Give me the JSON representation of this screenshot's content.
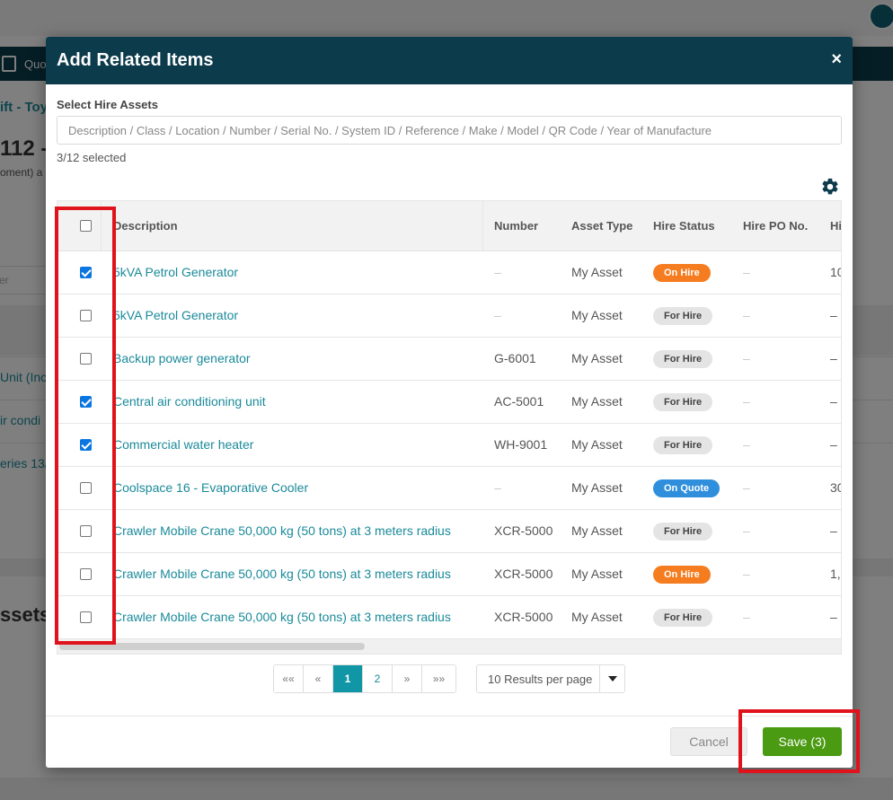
{
  "background": {
    "nav_label": "Quo",
    "title_fragment": "ift - Toy",
    "number_fragment": "112 -",
    "sub_fragment": "oment) a",
    "input_placeholder": "er",
    "rows": [
      "Unit (Inc",
      "ir condi",
      "eries 13/"
    ],
    "section_title": "ssets"
  },
  "modal": {
    "title": "Add Related Items",
    "close_label": "×",
    "field_label": "Select Hire Assets",
    "search_placeholder": "Description / Class / Location / Number / Serial No. / System ID / Reference / Make / Model / QR Code / Year of Manufacture",
    "selected_text": "3/12 selected"
  },
  "table": {
    "headers": {
      "description": "Description",
      "number": "Number",
      "asset_type": "Asset Type",
      "hire_status": "Hire Status",
      "hire_po": "Hire PO No.",
      "next": "Hi"
    },
    "rows": [
      {
        "checked": true,
        "description": "5kVA Petrol Generator",
        "number": "–",
        "asset_type": "My Asset",
        "hire_status": "On Hire",
        "status_kind": "onhire",
        "hire_po": "–",
        "extra": "10"
      },
      {
        "checked": false,
        "description": "5kVA Petrol Generator",
        "number": "–",
        "asset_type": "My Asset",
        "hire_status": "For Hire",
        "status_kind": "forhire",
        "hire_po": "–",
        "extra": "–"
      },
      {
        "checked": false,
        "description": "Backup power generator",
        "number": "G-6001",
        "asset_type": "My Asset",
        "hire_status": "For Hire",
        "status_kind": "forhire",
        "hire_po": "–",
        "extra": "–"
      },
      {
        "checked": true,
        "description": "Central air conditioning unit",
        "number": "AC-5001",
        "asset_type": "My Asset",
        "hire_status": "For Hire",
        "status_kind": "forhire",
        "hire_po": "–",
        "extra": "–"
      },
      {
        "checked": true,
        "description": "Commercial water heater",
        "number": "WH-9001",
        "asset_type": "My Asset",
        "hire_status": "For Hire",
        "status_kind": "forhire",
        "hire_po": "–",
        "extra": "–"
      },
      {
        "checked": false,
        "description": "Coolspace 16 - Evaporative Cooler",
        "number": "–",
        "asset_type": "My Asset",
        "hire_status": "On Quote",
        "status_kind": "onquote",
        "hire_po": "–",
        "extra": "30"
      },
      {
        "checked": false,
        "description": "Crawler Mobile Crane 50,000 kg (50 tons) at 3 meters radius",
        "number": "XCR-5000",
        "asset_type": "My Asset",
        "hire_status": "For Hire",
        "status_kind": "forhire",
        "hire_po": "–",
        "extra": "–"
      },
      {
        "checked": false,
        "description": "Crawler Mobile Crane 50,000 kg (50 tons) at 3 meters radius",
        "number": "XCR-5000",
        "asset_type": "My Asset",
        "hire_status": "On Hire",
        "status_kind": "onhire",
        "hire_po": "–",
        "extra": "1,"
      },
      {
        "checked": false,
        "description": "Crawler Mobile Crane 50,000 kg (50 tons) at 3 meters radius",
        "number": "XCR-5000",
        "asset_type": "My Asset",
        "hire_status": "For Hire",
        "status_kind": "forhire",
        "hire_po": "–",
        "extra": "–"
      }
    ]
  },
  "pagination": {
    "first": "««",
    "prev": "«",
    "pages": [
      "1",
      "2"
    ],
    "current": "1",
    "next": "»",
    "last": "»»",
    "per_page": "10 Results per page"
  },
  "footer": {
    "cancel_label": "Cancel",
    "save_label": "Save (3)"
  },
  "colors": {
    "header_bg": "#0c3b4b",
    "link": "#1a8a9a",
    "on_hire": "#f57c1f",
    "on_quote": "#2f8fdc",
    "save": "#4a9a12",
    "highlight": "#e0121b"
  }
}
